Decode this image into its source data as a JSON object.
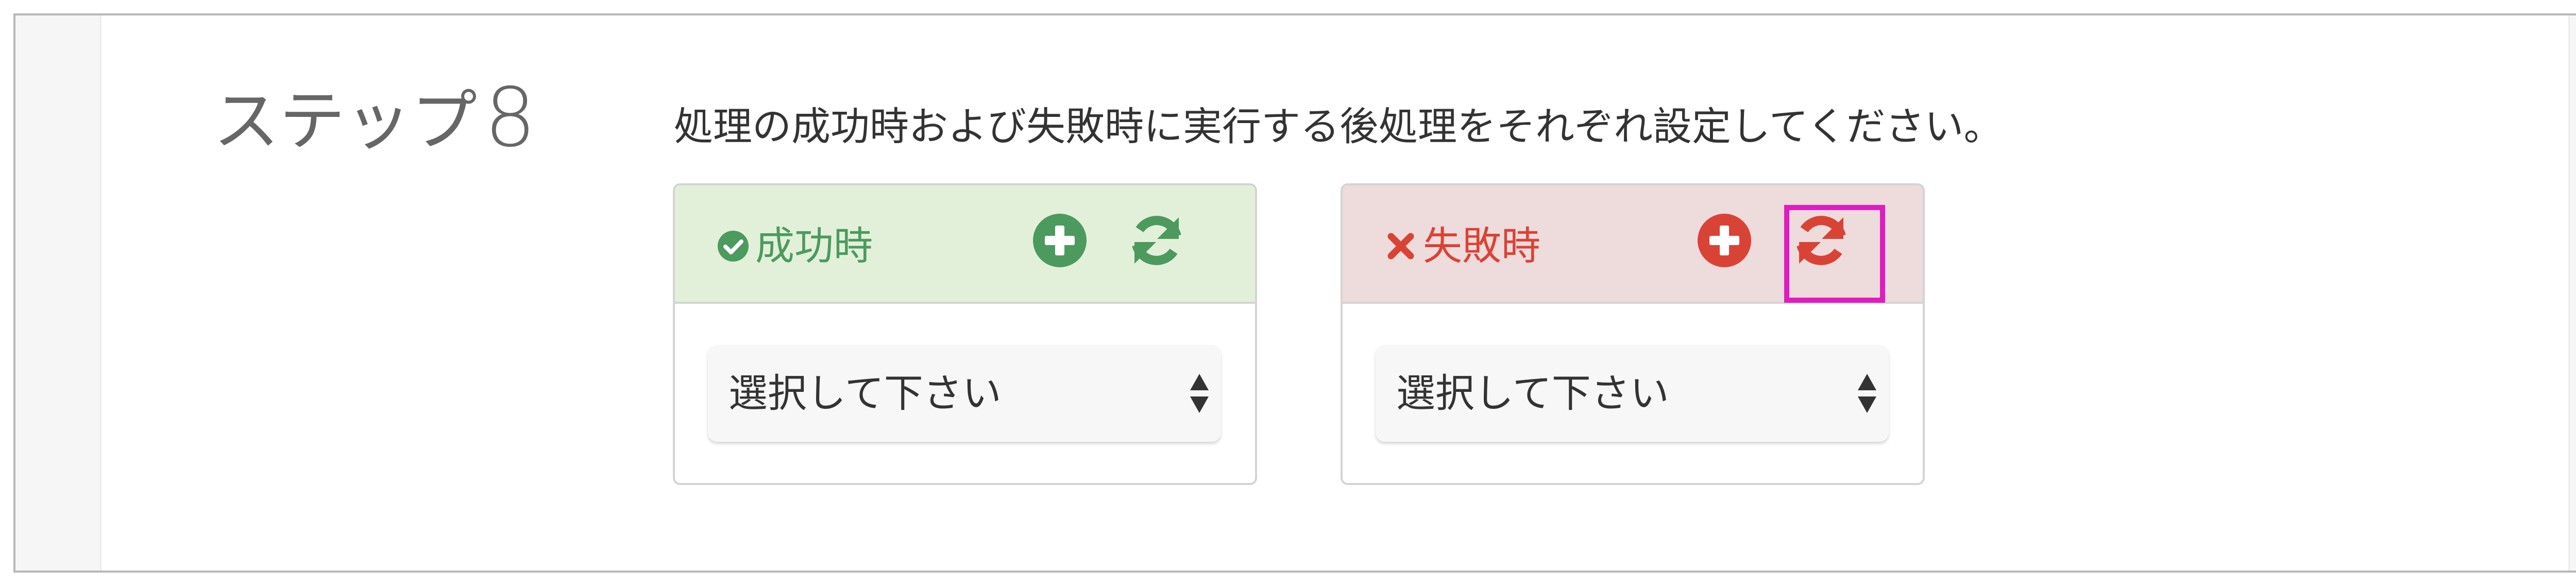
{
  "step": {
    "label": "ステップ",
    "number": "8"
  },
  "description": "処理の成功時および失敗時に実行する後処理をそれぞれ設定してください。",
  "panels": {
    "success": {
      "title": "成功時",
      "select_value": "選択して下さい",
      "color": "#4c9a5e",
      "header_bg": "#e2f0d9",
      "icon": "check-circle-icon"
    },
    "failure": {
      "title": "失敗時",
      "select_value": "選択して下さい",
      "color": "#d94336",
      "header_bg": "#eedbdb",
      "icon": "x-icon"
    }
  },
  "highlight_color": "#e01cc0"
}
